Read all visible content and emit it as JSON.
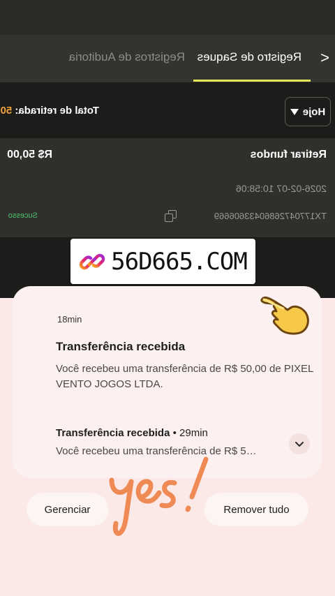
{
  "header": {
    "back_icon": "chevron-right-icon",
    "tabs": [
      {
        "label": "Registro de Saques",
        "active": true
      },
      {
        "label": "Registros de Auditoria",
        "active": false
      }
    ]
  },
  "filter": {
    "period_label": "Hoje"
  },
  "summary": {
    "total_label": "Total de retirada:",
    "total_value": "50"
  },
  "transaction": {
    "type": "Retirar fundos",
    "amount": "R$ 50,00",
    "datetime": "2026-02-07 10:58:06",
    "id": "TX17704726860433606669",
    "status": "Sucesso"
  },
  "banner": {
    "text": "56D665.COM"
  },
  "notifications": [
    {
      "time": "18min",
      "title": "Transferência recebida",
      "body": "Você recebeu uma transferência de R$ 50,00 de PIXEL VENTO JOGOS LTDA."
    },
    {
      "time": "29min",
      "title": "Transferência recebida",
      "separator": "•",
      "body": "Você recebeu uma transferência de R$ 5…"
    }
  ],
  "actions": {
    "manage_label": "Gerenciar",
    "remove_all_label": "Remover tudo"
  },
  "stickers": {
    "yes": "yes!",
    "hand": "pointing-hand-icon"
  },
  "colors": {
    "accent_underline": "#e3e65a",
    "amount_orange": "#f0a23a",
    "success_green": "#4cc46b"
  }
}
